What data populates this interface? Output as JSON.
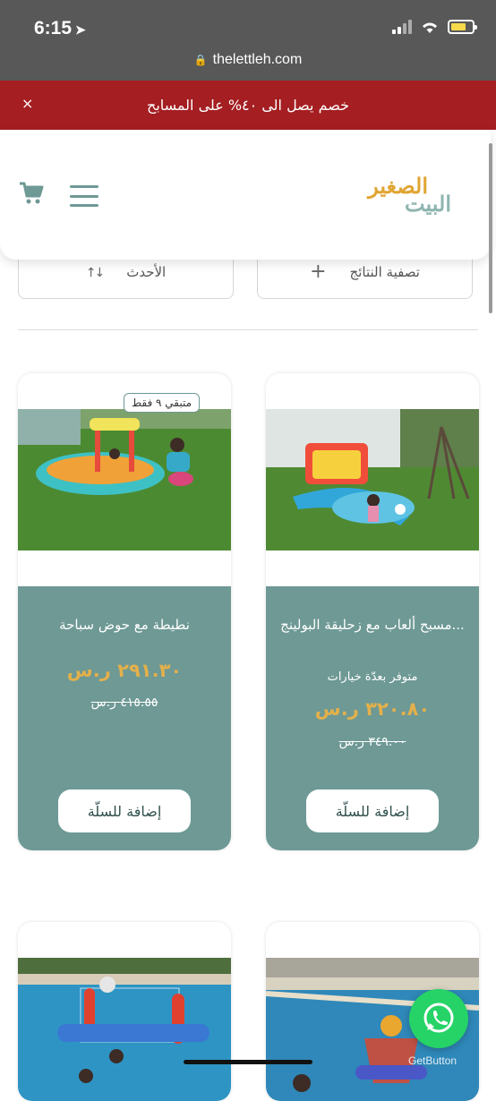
{
  "status_bar": {
    "time": "6:15",
    "url": "thelettleh.com"
  },
  "promo": {
    "text": "خصم يصل الى ٤٠% على المسابح",
    "close": "×"
  },
  "header": {
    "logo_top": "الصغير",
    "logo_bottom": "البيت"
  },
  "toolbar": {
    "filter_label": "تصفية النتائج",
    "sort_label": "الأحدث"
  },
  "products": [
    {
      "title": "مسبح ألعاب مع زحليقة البولينج...",
      "options_note": "متوفر بعدّة خيارات",
      "price": "٣٢٠.٨٠ ر.س",
      "old_price": "٣٤٩.٠٠ ر.س",
      "button": "إضافة للسلّة"
    },
    {
      "title": "نطيطة مع حوض سباحة",
      "badge": "متبقي ٩ فقط",
      "price": "٢٩١.٣٠ ر.س",
      "old_price": "٤١٥.٥٥ ر.س",
      "button": "إضافة للسلّة"
    }
  ],
  "floating": {
    "watermark": "GetButton"
  },
  "colors": {
    "accent": "#6e9995",
    "price": "#e3b04b",
    "promo": "#a41e22"
  }
}
